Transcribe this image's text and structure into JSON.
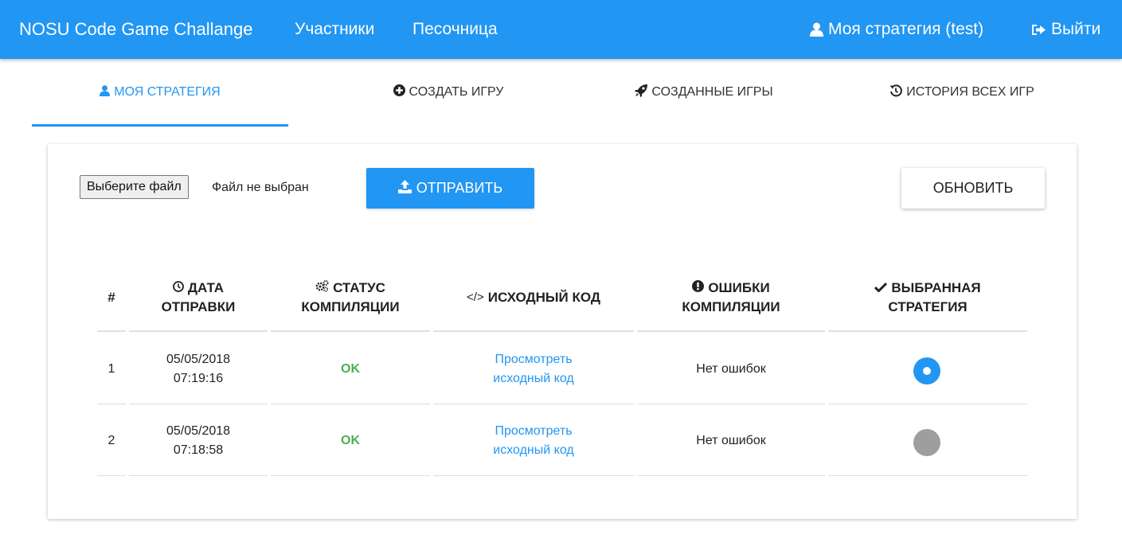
{
  "navbar": {
    "brand": "NOSU Code Game Challange",
    "links": [
      "Участники",
      "Песочница"
    ],
    "my_strategy": "Моя стратегия (test)",
    "logout": "Выйти"
  },
  "tabs": [
    {
      "label": "МОЯ СТРАТЕГИЯ",
      "icon": "user-icon",
      "active": true
    },
    {
      "label": "СОЗДАТЬ ИГРУ",
      "icon": "plus-circle-icon",
      "active": false
    },
    {
      "label": "СОЗДАННЫЕ ИГРЫ",
      "icon": "rocket-icon",
      "active": false
    },
    {
      "label": "ИСТОРИЯ ВСЕХ ИГР",
      "icon": "history-icon",
      "active": false
    }
  ],
  "upload": {
    "file_button": "Выберите файл",
    "file_status": "Файл не выбран",
    "send_label": "ОТПРАВИТЬ",
    "refresh_label": "ОБНОВИТЬ"
  },
  "table": {
    "headers": {
      "num": "#",
      "date_1": "ДАТА",
      "date_2": "ОТПРАВКИ",
      "status_1": "СТАТУС",
      "status_2": "КОМПИЛЯЦИИ",
      "source": "ИСХОДНЫЙ КОД",
      "errors_1": "ОШИБКИ",
      "errors_2": "КОМПИЛЯЦИИ",
      "selected_1": "ВЫБРАННАЯ",
      "selected_2": "СТРАТЕГИЯ"
    },
    "rows": [
      {
        "num": "1",
        "date": "05/05/2018",
        "time": "07:19:16",
        "status": "OK",
        "link_1": "Просмотреть",
        "link_2": "исходный код",
        "errors": "Нет ошибок",
        "selected": true
      },
      {
        "num": "2",
        "date": "05/05/2018",
        "time": "07:18:58",
        "status": "OK",
        "link_1": "Просмотреть",
        "link_2": "исходный код",
        "errors": "Нет ошибок",
        "selected": false
      }
    ]
  },
  "colors": {
    "primary": "#2196f3",
    "ok": "#4caf50",
    "radio_off": "#9e9e9e"
  }
}
